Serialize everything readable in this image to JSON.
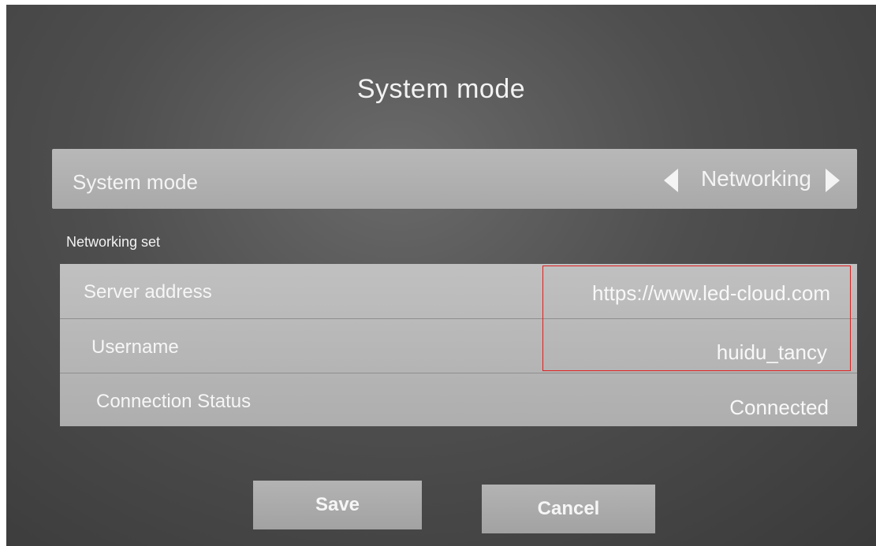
{
  "dialog": {
    "title": "System mode"
  },
  "system_mode": {
    "label": "System mode",
    "value": "Networking"
  },
  "networking": {
    "section_label": "Networking set",
    "rows": [
      {
        "label": "Server address",
        "value": "https://www.led-cloud.com"
      },
      {
        "label": "Username",
        "value": "huidu_tancy"
      },
      {
        "label": "Connection Status",
        "value": "Connected"
      }
    ]
  },
  "buttons": {
    "save": "Save",
    "cancel": "Cancel"
  },
  "colors": {
    "highlight_box": "#e02020"
  }
}
